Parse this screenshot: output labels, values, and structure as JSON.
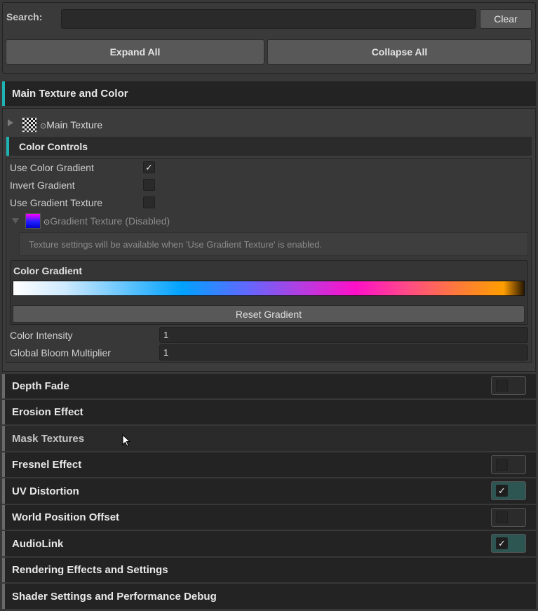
{
  "search": {
    "label": "Search:",
    "value": "",
    "clear_label": "Clear"
  },
  "buttons": {
    "expand_all": "Expand All",
    "collapse_all": "Collapse All"
  },
  "main_section": {
    "title": "Main Texture and Color",
    "main_texture_label": "Main Texture",
    "picker_glyph": "⊙",
    "color_controls": {
      "title": "Color Controls",
      "use_color_gradient": {
        "label": "Use Color Gradient",
        "checked": true
      },
      "invert_gradient": {
        "label": "Invert Gradient",
        "checked": false
      },
      "use_gradient_texture": {
        "label": "Use Gradient Texture",
        "checked": false
      },
      "gradient_texture_label": "Gradient Texture (Disabled)",
      "help_text": "Texture settings will be available when 'Use Gradient Texture' is enabled.",
      "color_gradient_title": "Color Gradient",
      "reset_gradient_label": "Reset Gradient",
      "color_intensity": {
        "label": "Color Intensity",
        "value": "1"
      },
      "global_bloom_multiplier": {
        "label": "Global Bloom Multiplier",
        "value": "1"
      }
    }
  },
  "sections": [
    {
      "title": "Depth Fade",
      "toggle": false
    },
    {
      "title": "Erosion Effect"
    },
    {
      "title": "Mask Textures"
    },
    {
      "title": "Fresnel Effect",
      "toggle": false
    },
    {
      "title": "UV Distortion",
      "toggle": true
    },
    {
      "title": "World Position Offset",
      "toggle": false
    },
    {
      "title": "AudioLink",
      "toggle": true
    },
    {
      "title": "Rendering Effects and Settings"
    },
    {
      "title": "Shader Settings and Performance Debug"
    }
  ],
  "check_glyph": "✓",
  "colors": {
    "accent": "#1fb3b3",
    "toggle_on": "#2d5552",
    "header_bg": "#232323",
    "panel_bg": "#383838"
  }
}
